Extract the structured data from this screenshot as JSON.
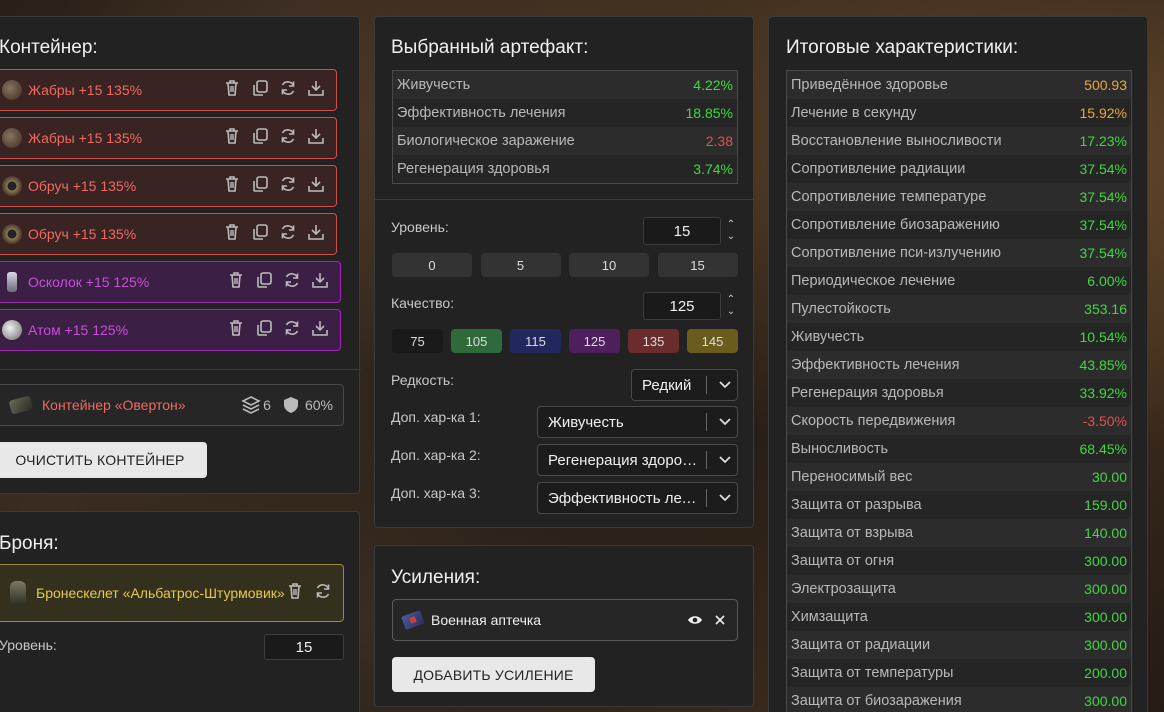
{
  "container": {
    "title": "Контейнер:",
    "items": [
      {
        "label": "Жабры +15 135%",
        "thumb": "gills-artifact-icon"
      },
      {
        "label": "Жабры +15 135%",
        "thumb": "gills-artifact-icon"
      },
      {
        "label": "Обруч +15 135%",
        "thumb": "hoop-artifact-icon"
      },
      {
        "label": "Обруч +15 135%",
        "thumb": "hoop-artifact-icon"
      },
      {
        "label": "Осколок +15 125%",
        "thumb": "shard-artifact-icon"
      },
      {
        "label": "Атом +15 125%",
        "thumb": "atom-artifact-icon"
      }
    ],
    "selected_container": {
      "name": "Контейнер «Овертон»",
      "slots": "6",
      "protection": "60%"
    },
    "clear_button": "ОЧИСТИТЬ КОНТЕЙНЕР"
  },
  "armor": {
    "title": "Броня:",
    "name": "Бронескелет «Альбатрос-Штурмовик»",
    "level_label": "Уровень:",
    "level_value": "15"
  },
  "artifact": {
    "title": "Выбранный артефакт:",
    "stats": [
      {
        "name": "Живучесть",
        "value": "4.22%",
        "color": "#3fd93f"
      },
      {
        "name": "Эффективность лечения",
        "value": "18.85%",
        "color": "#3fd93f"
      },
      {
        "name": "Биологическое заражение",
        "value": "2.38",
        "color": "#e0524a"
      },
      {
        "name": "Регенерация здоровья",
        "value": "3.74%",
        "color": "#3fd93f"
      }
    ],
    "level_label": "Уровень:",
    "level_value": "15",
    "level_presets": [
      "0",
      "5",
      "10",
      "15"
    ],
    "quality_label": "Качество:",
    "quality_value": "125",
    "quality_presets": [
      {
        "label": "75",
        "color": "#1a1a1a"
      },
      {
        "label": "105",
        "color": "#2f6b3a"
      },
      {
        "label": "115",
        "color": "#22285e"
      },
      {
        "label": "125",
        "color": "#4e1f5c"
      },
      {
        "label": "135",
        "color": "#6a2c2c"
      },
      {
        "label": "145",
        "color": "#6a5c1c"
      }
    ],
    "rarity_label": "Редкость:",
    "rarity_value": "Редкий",
    "extra1_label": "Доп. хар-ка 1:",
    "extra1_value": "Живучесть",
    "extra2_label": "Доп. хар-ка 2:",
    "extra2_value": "Регенерация здоровья",
    "extra3_label": "Доп. хар-ка 3:",
    "extra3_value": "Эффективность лечения"
  },
  "boosts": {
    "title": "Усиления:",
    "item": "Военная аптечка",
    "add_button": "ДОБАВИТЬ УСИЛЕНИЕ"
  },
  "totals": {
    "title": "Итоговые характеристики:",
    "stats": [
      {
        "name": "Приведённое здоровье",
        "value": "500.93",
        "color": "#e8a83a"
      },
      {
        "name": "Лечение в секунду",
        "value": "15.92%",
        "color": "#e8a83a"
      },
      {
        "name": "Восстановление выносливости",
        "value": "17.23%",
        "color": "#3fd93f"
      },
      {
        "name": "Сопротивление радиации",
        "value": "37.54%",
        "color": "#3fd93f"
      },
      {
        "name": "Сопротивление температуре",
        "value": "37.54%",
        "color": "#3fd93f"
      },
      {
        "name": "Сопротивление биозаражению",
        "value": "37.54%",
        "color": "#3fd93f"
      },
      {
        "name": "Сопротивление пси-излучению",
        "value": "37.54%",
        "color": "#3fd93f"
      },
      {
        "name": "Периодическое лечение",
        "value": "6.00%",
        "color": "#3fd93f"
      },
      {
        "name": "Пулестойкость",
        "value": "353.16",
        "color": "#3fd93f"
      },
      {
        "name": "Живучесть",
        "value": "10.54%",
        "color": "#3fd93f"
      },
      {
        "name": "Эффективность лечения",
        "value": "43.85%",
        "color": "#3fd93f"
      },
      {
        "name": "Регенерация здоровья",
        "value": "33.92%",
        "color": "#3fd93f"
      },
      {
        "name": "Скорость передвижения",
        "value": "-3.50%",
        "color": "#e0524a"
      },
      {
        "name": "Выносливость",
        "value": "68.45%",
        "color": "#3fd93f"
      },
      {
        "name": "Переносимый вес",
        "value": "30.00",
        "color": "#3fd93f"
      },
      {
        "name": "Защита от разрыва",
        "value": "159.00",
        "color": "#3fd93f"
      },
      {
        "name": "Защита от взрыва",
        "value": "140.00",
        "color": "#3fd93f"
      },
      {
        "name": "Защита от огня",
        "value": "300.00",
        "color": "#3fd93f"
      },
      {
        "name": "Электрозащита",
        "value": "300.00",
        "color": "#3fd93f"
      },
      {
        "name": "Химзащита",
        "value": "300.00",
        "color": "#3fd93f"
      },
      {
        "name": "Защита от радиации",
        "value": "300.00",
        "color": "#3fd93f"
      },
      {
        "name": "Защита от температуры",
        "value": "200.00",
        "color": "#3fd93f"
      },
      {
        "name": "Защита от биозаражения",
        "value": "300.00",
        "color": "#3fd93f"
      }
    ]
  }
}
